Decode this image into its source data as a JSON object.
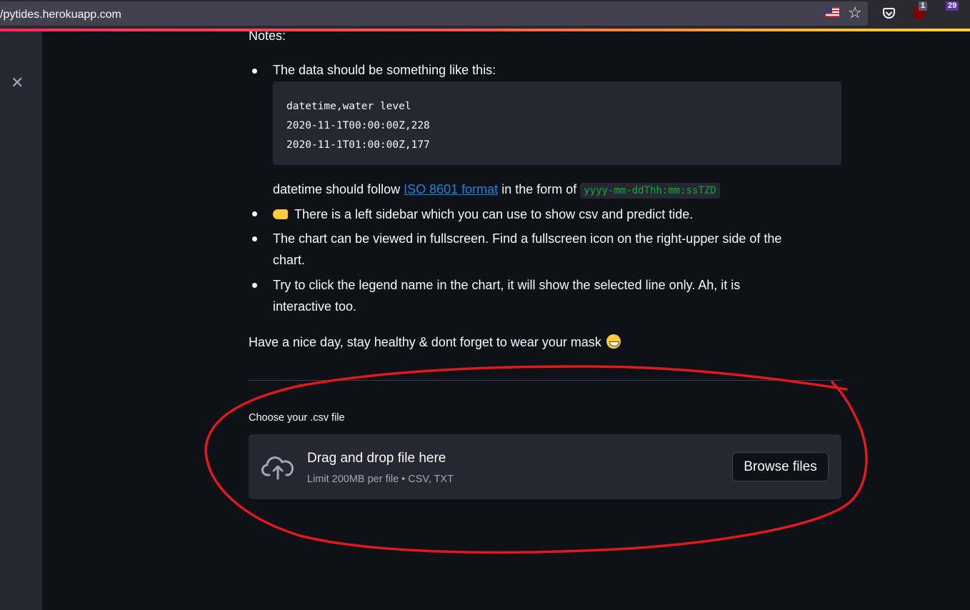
{
  "browser": {
    "url": "/pytides.herokuapp.com",
    "ublock_count": "1",
    "extension_count": "29"
  },
  "sidebar": {
    "close_symbol": "✕"
  },
  "notes": {
    "heading": "Notes:",
    "item1": "The data should be something like this:",
    "code_lines": [
      "datetime,water level",
      "2020-11-1T00:00:00Z,228",
      "2020-11-1T01:00:00Z,177"
    ],
    "datetime_prefix": "datetime should follow ",
    "datetime_link": "ISO 8601 format",
    "datetime_middle": " in the form of ",
    "datetime_format": "yyyy-mm-ddThh:mm:ssTZD",
    "item2": "There is a left sidebar which you can use to show csv and predict tide.",
    "item3_line1": "The chart can be viewed in fullscreen. Find a fullscreen icon on the right-upper side of the",
    "item3_line2": "chart.",
    "item4_line1": "Try to click the legend name in the chart, it will show the selected line only. Ah, it is",
    "item4_line2": "interactive too."
  },
  "closing_text": "Have a nice day, stay healthy & dont forget to wear your mask ",
  "uploader": {
    "label": "Choose your .csv file",
    "drop_title": "Drag and drop file here",
    "drop_sub": "Limit 200MB per file • CSV, TXT",
    "browse_label": "Browse files"
  },
  "colors": {
    "background": "#0e1117",
    "secondary_background": "#262730",
    "link": "#1c83e1",
    "inline_code": "#09ab3b",
    "annotation": "#e0191c"
  },
  "icons": [
    "flag-icon",
    "star-icon",
    "pocket-icon",
    "ublock-icon",
    "close-icon",
    "pointing-hand-icon",
    "grin-icon",
    "cloud-upload-icon"
  ]
}
